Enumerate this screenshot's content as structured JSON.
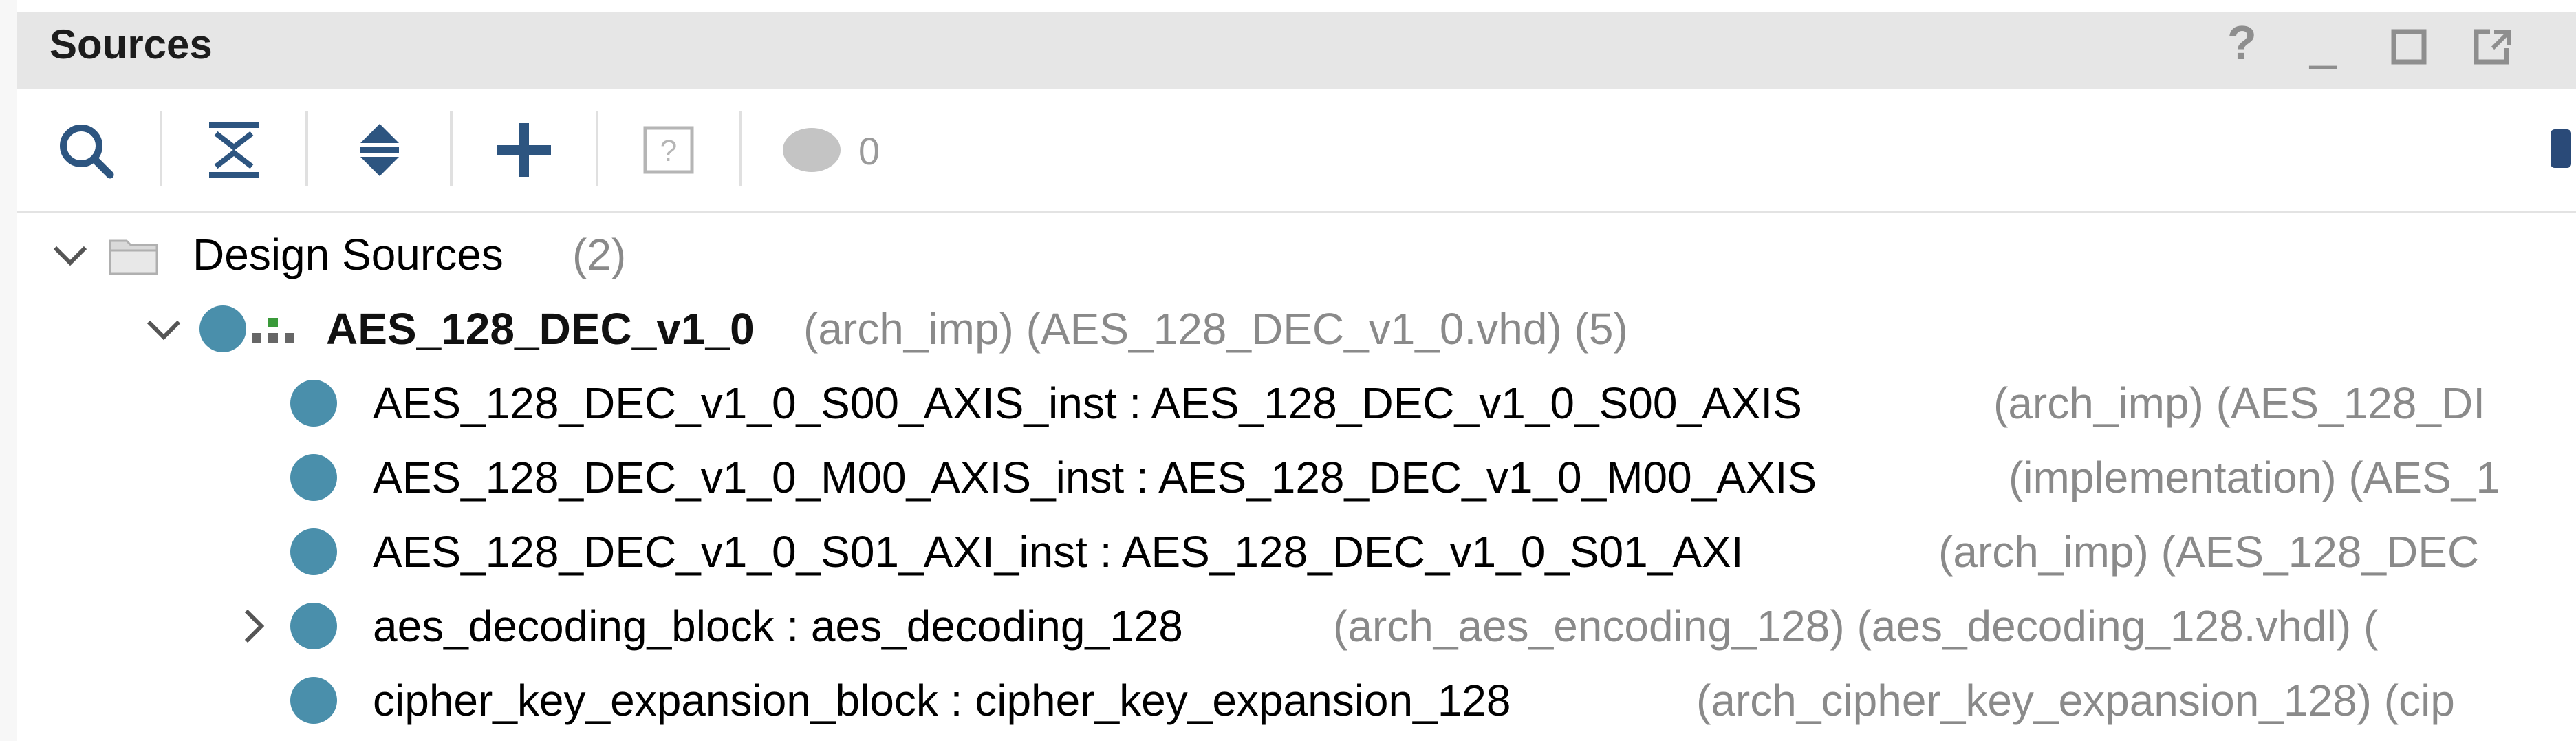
{
  "panel": {
    "title": "Sources",
    "help_glyph": "?",
    "minimize_glyph": "_"
  },
  "toolbar": {
    "search": "search-icon",
    "collapse_all": "collapse-all-icon",
    "expand_all": "expand-all-icon",
    "add_sources": "add-icon",
    "properties": "help-box-icon",
    "status_count": "0"
  },
  "tree": {
    "root_label": "Design Sources",
    "root_count": "(2)",
    "top": {
      "name": "AES_128_DEC_v1_0",
      "detail": "(arch_imp) (AES_128_DEC_v1_0.vhd) (5)"
    },
    "children": [
      {
        "label": "AES_128_DEC_v1_0_S00_AXIS_inst : AES_128_DEC_v1_0_S00_AXIS",
        "detail": "(arch_imp) (AES_128_DI"
      },
      {
        "label": "AES_128_DEC_v1_0_M00_AXIS_inst : AES_128_DEC_v1_0_M00_AXIS",
        "detail": "(implementation) (AES_1"
      },
      {
        "label": "AES_128_DEC_v1_0_S01_AXI_inst : AES_128_DEC_v1_0_S01_AXI",
        "detail": "(arch_imp) (AES_128_DEC"
      },
      {
        "label": "aes_decoding_block : aes_decoding_128",
        "detail": "(arch_aes_encoding_128) (aes_decoding_128.vhdl) ("
      },
      {
        "label": "cipher_key_expansion_block : cipher_key_expansion_128",
        "detail": "(arch_cipher_key_expansion_128) (cip"
      }
    ]
  },
  "colors": {
    "accent": "#4a8fab",
    "title_bar": "#e6e6e6",
    "muted_text": "#8a8a8a"
  }
}
